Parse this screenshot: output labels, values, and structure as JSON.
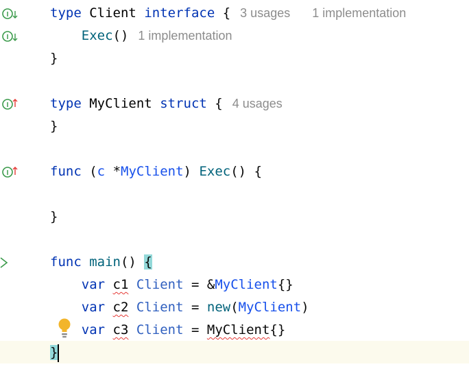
{
  "editor": {
    "lines": [
      {
        "parts": [
          "type",
          "Client",
          "interface",
          "{"
        ],
        "hints": [
          "3 usages",
          "1 implementation"
        ]
      },
      {
        "parts": [
          "Exec",
          "()"
        ],
        "hints": [
          "1 implementation"
        ]
      },
      {
        "parts": [
          "}"
        ]
      },
      {
        "parts": [
          "type",
          "MyClient",
          "struct",
          "{"
        ],
        "hints": [
          "4 usages"
        ]
      },
      {
        "parts": [
          "}"
        ]
      },
      {
        "parts": [
          "func",
          "(",
          "c",
          "*",
          "MyClient",
          ")",
          "Exec",
          "()",
          "{"
        ]
      },
      {
        "parts": [
          "}"
        ]
      },
      {
        "parts": [
          "func",
          "main",
          "()",
          "{"
        ]
      },
      {
        "parts": [
          "var",
          "c1",
          "Client",
          "=",
          "&",
          "MyClient",
          "{}"
        ]
      },
      {
        "parts": [
          "var",
          "c2",
          "Client",
          "=",
          "new",
          "(",
          "MyClient",
          ")"
        ]
      },
      {
        "parts": [
          "var",
          "c3",
          "Client",
          "=",
          "MyClient",
          "{}"
        ]
      },
      {
        "parts": [
          "}"
        ]
      }
    ]
  },
  "colors": {
    "keyword": "#0033b3",
    "function_name": "#00627a",
    "type_ref": "#1750eb",
    "inlay_hint": "#8c8c8c",
    "caret_line": "#fcfaed",
    "brace_match": "#93d9d9",
    "error_squiggle": "#e53935",
    "gutter_icon": "#3a9a4a"
  },
  "icons": {
    "implemented": "interface-implemented-icon",
    "implements": "implements-interface-icon",
    "run": "run-gutter-icon",
    "intention": "lightbulb-icon"
  }
}
